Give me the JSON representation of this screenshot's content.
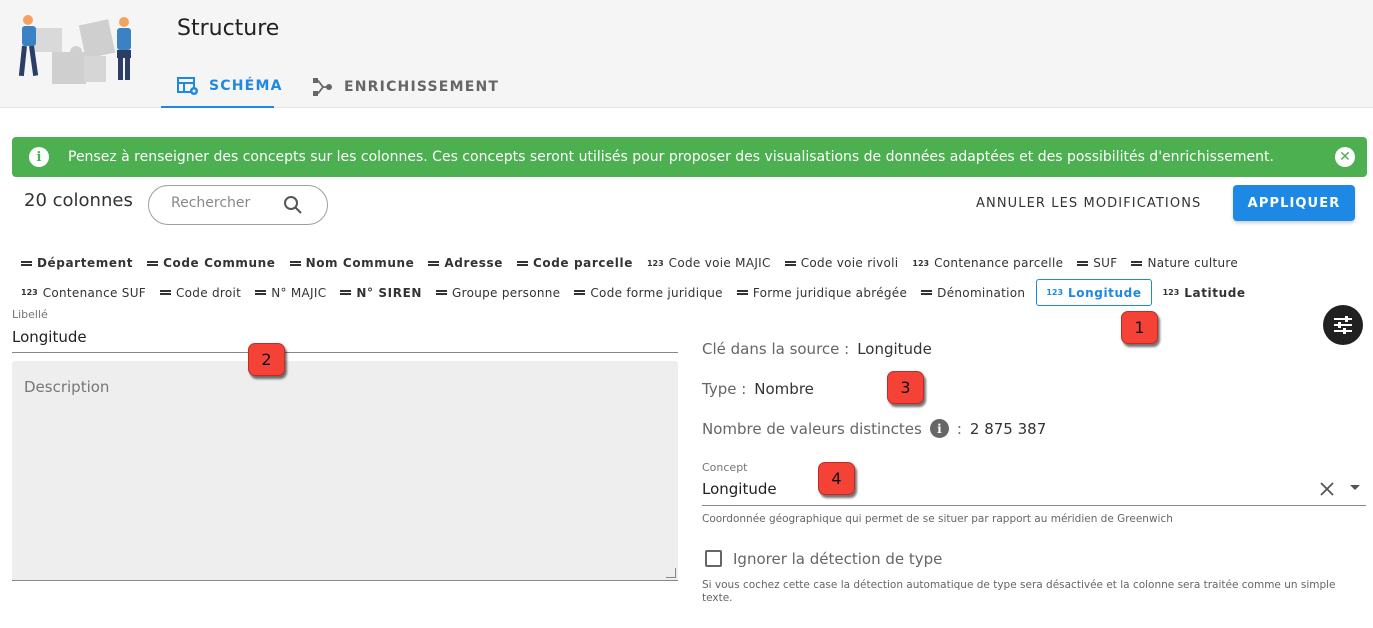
{
  "header": {
    "title": "Structure",
    "tabs": [
      {
        "label": "SCHÉMA",
        "icon": "schema-table-icon",
        "active": true
      },
      {
        "label": "ENRICHISSEMENT",
        "icon": "enrichment-graph-icon",
        "active": false
      }
    ]
  },
  "alert": {
    "text": "Pensez à renseigner des concepts sur les colonnes. Ces concepts seront utilisés pour proposer des visualisations de données adaptées et des possibilités d'enrichissement.",
    "color": "#4caf50"
  },
  "toolbar": {
    "column_count": "20 colonnes",
    "search_placeholder": "Rechercher",
    "cancel_label": "ANNULER LES MODIFICATIONS",
    "apply_label": "APPLIQUER"
  },
  "columns_row1": [
    {
      "label": "Département",
      "type": "text",
      "bold": true
    },
    {
      "label": "Code Commune",
      "type": "text",
      "bold": true
    },
    {
      "label": "Nom Commune",
      "type": "text",
      "bold": true
    },
    {
      "label": "Adresse",
      "type": "text",
      "bold": true
    },
    {
      "label": "Code parcelle",
      "type": "text",
      "bold": true
    },
    {
      "label": "Code voie MAJIC",
      "type": "number",
      "bold": false
    },
    {
      "label": "Code voie rivoli",
      "type": "text",
      "bold": false
    },
    {
      "label": "Contenance parcelle",
      "type": "number",
      "bold": false
    },
    {
      "label": "SUF",
      "type": "text",
      "bold": false
    },
    {
      "label": "Nature culture",
      "type": "text",
      "bold": false
    }
  ],
  "columns_row2": [
    {
      "label": "Contenance SUF",
      "type": "number",
      "bold": false
    },
    {
      "label": "Code droit",
      "type": "text",
      "bold": false
    },
    {
      "label": "N° MAJIC",
      "type": "text",
      "bold": false
    },
    {
      "label": "N° SIREN",
      "type": "text",
      "bold": true
    },
    {
      "label": "Groupe personne",
      "type": "text",
      "bold": false
    },
    {
      "label": "Code forme juridique",
      "type": "text",
      "bold": false
    },
    {
      "label": "Forme juridique abrégée",
      "type": "text",
      "bold": false
    },
    {
      "label": "Dénomination",
      "type": "text",
      "bold": false
    },
    {
      "label": "Longitude",
      "type": "number",
      "bold": true,
      "selected": true
    },
    {
      "label": "Latitude",
      "type": "number",
      "bold": true
    }
  ],
  "type_icons": {
    "number": "123"
  },
  "form": {
    "libelle_label": "Libellé",
    "libelle_value": "Longitude",
    "description_placeholder": "Description"
  },
  "details": {
    "key_label": "Clé dans la source :",
    "key_value": "Longitude",
    "type_label": "Type :",
    "type_value": "Nombre",
    "distinct_label": "Nombre de valeurs distinctes",
    "distinct_sep": ":",
    "distinct_value": "2 875 387",
    "concept_label": "Concept",
    "concept_value": "Longitude",
    "concept_hint": "Coordonnée géographique qui permet de se situer par rapport au méridien de Greenwich",
    "ignore_label": "Ignorer la détection de type",
    "ignore_checked": false,
    "ignore_hint": "Si vous cochez cette case la détection automatique de type sera désactivée et la colonne sera traitée comme un simple texte."
  },
  "markers": [
    "1",
    "2",
    "3",
    "4"
  ],
  "colors": {
    "accent": "#1e88e5",
    "alert_green": "#4caf50",
    "marker_red": "#f44336"
  }
}
